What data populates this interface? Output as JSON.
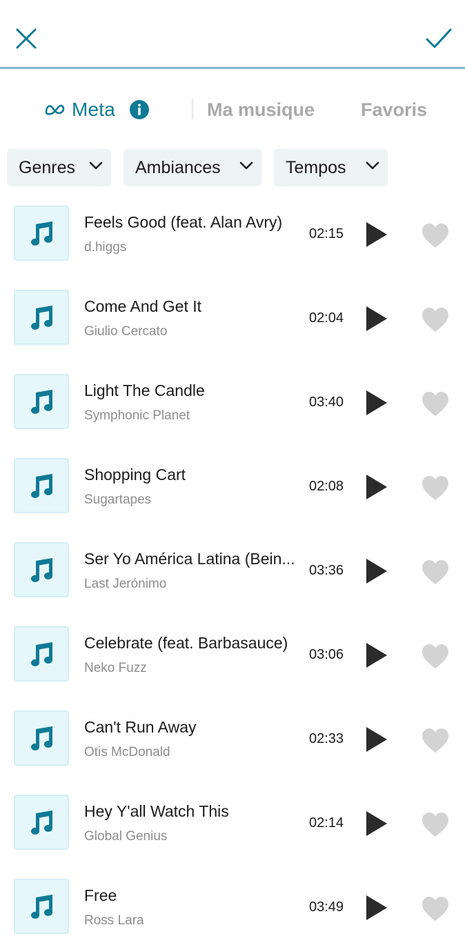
{
  "colors": {
    "accent": "#0f7a95",
    "divider": "#7fb8c6",
    "tab_inactive": "#a9a9a9",
    "filter_bg": "#eef3f4",
    "thumb_bg": "#e5f7fb",
    "heart": "#d3d3d3",
    "artist_text": "#8d8d8d"
  },
  "header": {
    "close_icon": "close-icon",
    "confirm_icon": "check-icon"
  },
  "tabs": [
    {
      "label": "Meta",
      "active": true,
      "icon": "meta-logo-icon",
      "badge_icon": "info-icon"
    },
    {
      "label": "Ma musique",
      "active": false
    },
    {
      "label": "Favoris",
      "active": false
    }
  ],
  "filters": [
    {
      "label": "Genres",
      "icon": "chevron-down-icon"
    },
    {
      "label": "Ambiances",
      "icon": "chevron-down-icon"
    },
    {
      "label": "Tempos",
      "icon": "chevron-down-icon"
    }
  ],
  "tracks": [
    {
      "title": "Feels Good (feat. Alan Avry)",
      "artist": "d.higgs",
      "duration": "02:15"
    },
    {
      "title": "Come And Get It",
      "artist": "Giulio Cercato",
      "duration": "02:04"
    },
    {
      "title": "Light The Candle",
      "artist": "Symphonic Planet",
      "duration": "03:40"
    },
    {
      "title": "Shopping Cart",
      "artist": "Sugartapes",
      "duration": "02:08"
    },
    {
      "title": "Ser Yo América Latina (Bein...",
      "artist": "Last Jerónimo",
      "duration": "03:36"
    },
    {
      "title": "Celebrate (feat. Barbasauce)",
      "artist": "Neko Fuzz",
      "duration": "03:06"
    },
    {
      "title": "Can't Run Away",
      "artist": "Otis McDonald",
      "duration": "02:33"
    },
    {
      "title": "Hey Y'all Watch This",
      "artist": "Global Genius",
      "duration": "02:14"
    },
    {
      "title": "Free",
      "artist": "Ross Lara",
      "duration": "03:49"
    }
  ]
}
